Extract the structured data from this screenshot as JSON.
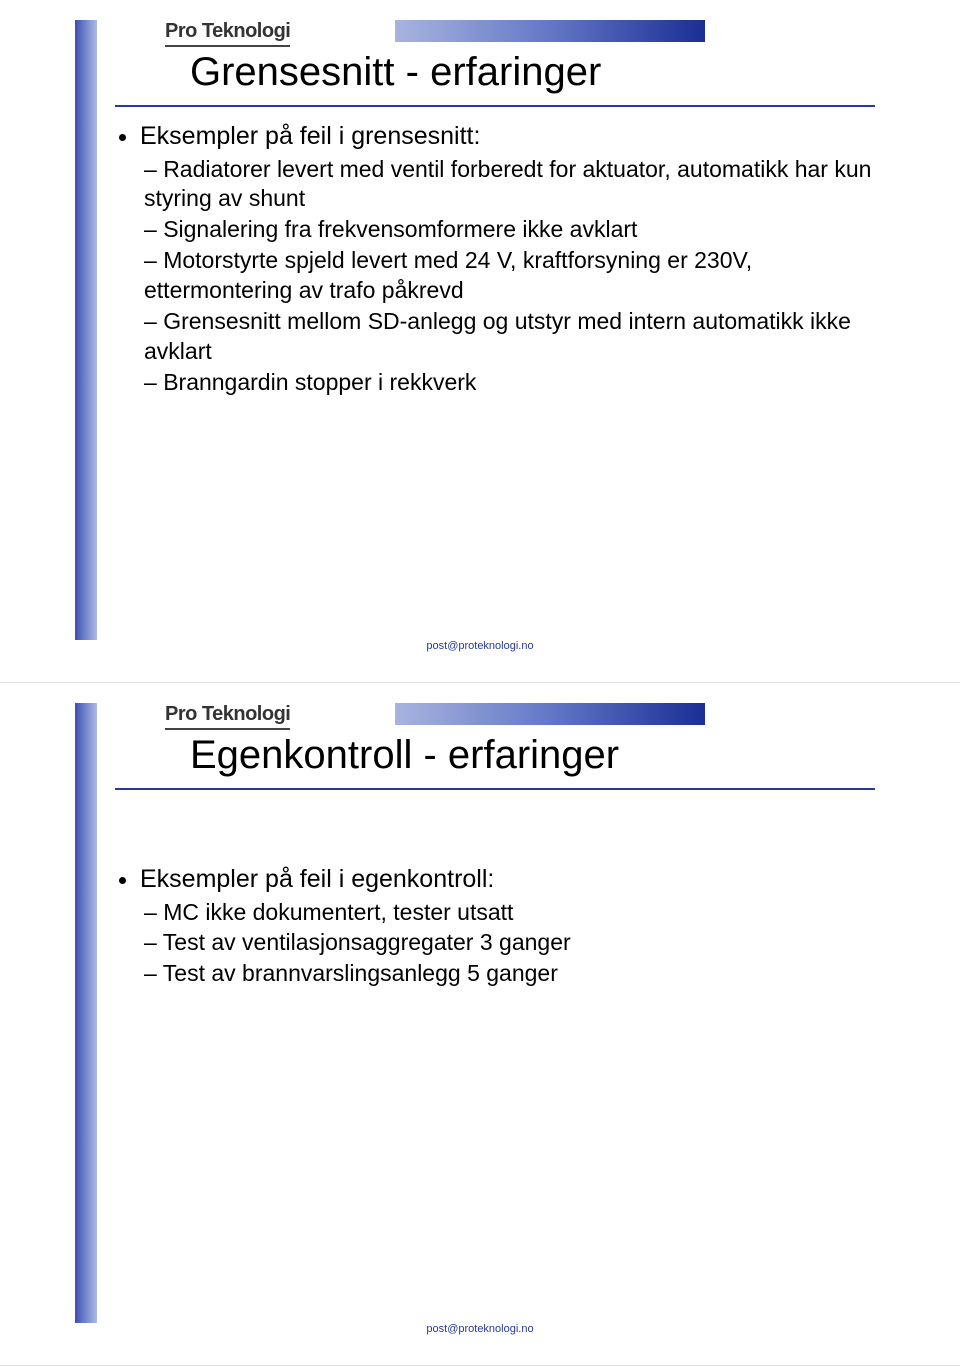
{
  "brand": "Pro Teknologi",
  "footer": "post@proteknologi.no",
  "slides": [
    {
      "title": "Grensesnitt - erfaringer",
      "bullet": "Eksempler på feil i grensesnitt:",
      "sub": [
        "Radiatorer levert med ventil forberedt for aktuator, automatikk har kun styring av shunt",
        "Signalering fra frekvensomformere ikke avklart",
        "Motorstyrte spjeld levert med 24 V, kraftforsyning er 230V, ettermontering av trafo påkrevd",
        "Grensesnitt mellom SD-anlegg og utstyr med intern automatikk ikke avklart",
        "Branngardin stopper i rekkverk"
      ]
    },
    {
      "title": "Egenkontroll - erfaringer",
      "bullet": "Eksempler på feil i egenkontroll:",
      "sub": [
        "MC ikke dokumentert, tester utsatt",
        "Test av ventilasjonsaggregater 3 ganger",
        "Test av brannvarslingsanlegg 5 ganger"
      ]
    }
  ]
}
